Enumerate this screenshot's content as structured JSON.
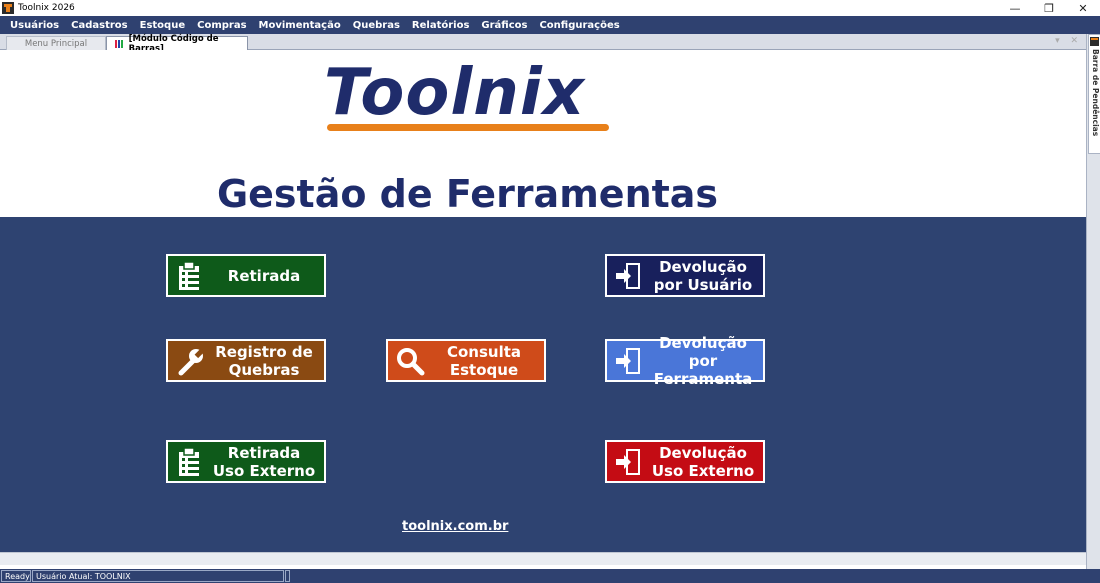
{
  "window": {
    "title": "Toolnix 2026",
    "controls": {
      "minimize": "—",
      "restore": "❐",
      "close": "✕"
    }
  },
  "menu": [
    "Usuários",
    "Cadastros",
    "Estoque",
    "Compras",
    "Movimentação",
    "Quebras",
    "Relatórios",
    "Gráficos",
    "Configurações"
  ],
  "tabs": {
    "menu_principal": "Menu Principal",
    "codigo_barras": "[Módulo Código de Barras]",
    "controls": "▾ ✕"
  },
  "side_panel": {
    "label": "Barra de Pendências"
  },
  "logo": {
    "text": "Toolnix"
  },
  "page_title": "Gestão de Ferramentas",
  "buttons": {
    "retirada": "Retirada",
    "devolucao_usuario": "Devolução\npor Usuário",
    "registro_quebras": "Registro de\nQuebras",
    "consulta_estoque": "Consulta\nEstoque",
    "devolucao_ferramenta": "Devolução\npor Ferramenta",
    "retirada_externo": "Retirada\nUso Externo",
    "devolucao_externo": "Devolução\nUso Externo"
  },
  "colors": {
    "menubar": "#2f4170",
    "main_bg": "#2e4371",
    "logo_text": "#1f2c6b",
    "logo_underline": "#e8801a",
    "green": "#0e5a1a",
    "navy": "#18205c",
    "brown": "#8a4a12",
    "orange": "#cf4b1a",
    "blue": "#4a76d8",
    "red": "#c40c14"
  },
  "footer_link": "toolnix.com.br",
  "status": {
    "ready": "Ready",
    "user": "Usuário Atual: TOOLNIX"
  }
}
